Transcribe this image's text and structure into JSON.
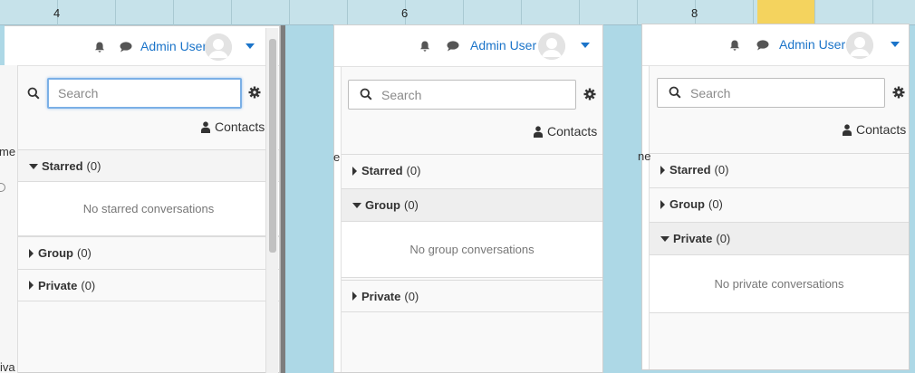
{
  "columns": {
    "labels": [
      "4",
      "6",
      "8"
    ]
  },
  "background_fragments": {
    "p1_left_text": "me",
    "p1_left_bottom": "iva",
    "p2_left_text": "e",
    "p3_left_text": "ne"
  },
  "panels": [
    {
      "user_name": "Admin User",
      "search_placeholder": "Search",
      "contacts_label": "Contacts",
      "sections": [
        {
          "name": "Starred",
          "count": "(0)",
          "open": true
        },
        {
          "name": "Group",
          "count": "(0)",
          "open": false
        },
        {
          "name": "Private",
          "count": "(0)",
          "open": false
        }
      ],
      "empty_message": "No starred conversations"
    },
    {
      "user_name": "Admin User",
      "search_placeholder": "Search",
      "contacts_label": "Contacts",
      "sections": [
        {
          "name": "Starred",
          "count": "(0)",
          "open": false
        },
        {
          "name": "Group",
          "count": "(0)",
          "open": true
        },
        {
          "name": "Private",
          "count": "(0)",
          "open": false
        }
      ],
      "empty_message": "No group conversations"
    },
    {
      "user_name": "Admin User",
      "search_placeholder": "Search",
      "contacts_label": "Contacts",
      "sections": [
        {
          "name": "Starred",
          "count": "(0)",
          "open": false
        },
        {
          "name": "Group",
          "count": "(0)",
          "open": false
        },
        {
          "name": "Private",
          "count": "(0)",
          "open": true
        }
      ],
      "empty_message": "No private conversations"
    }
  ],
  "colors": {
    "accent": "#1b74c9",
    "page_bg": "#add8e6"
  },
  "icons": [
    "bell-icon",
    "chat-icon",
    "avatar",
    "caret-down-icon",
    "search-icon",
    "gear-icon",
    "user-icon"
  ]
}
